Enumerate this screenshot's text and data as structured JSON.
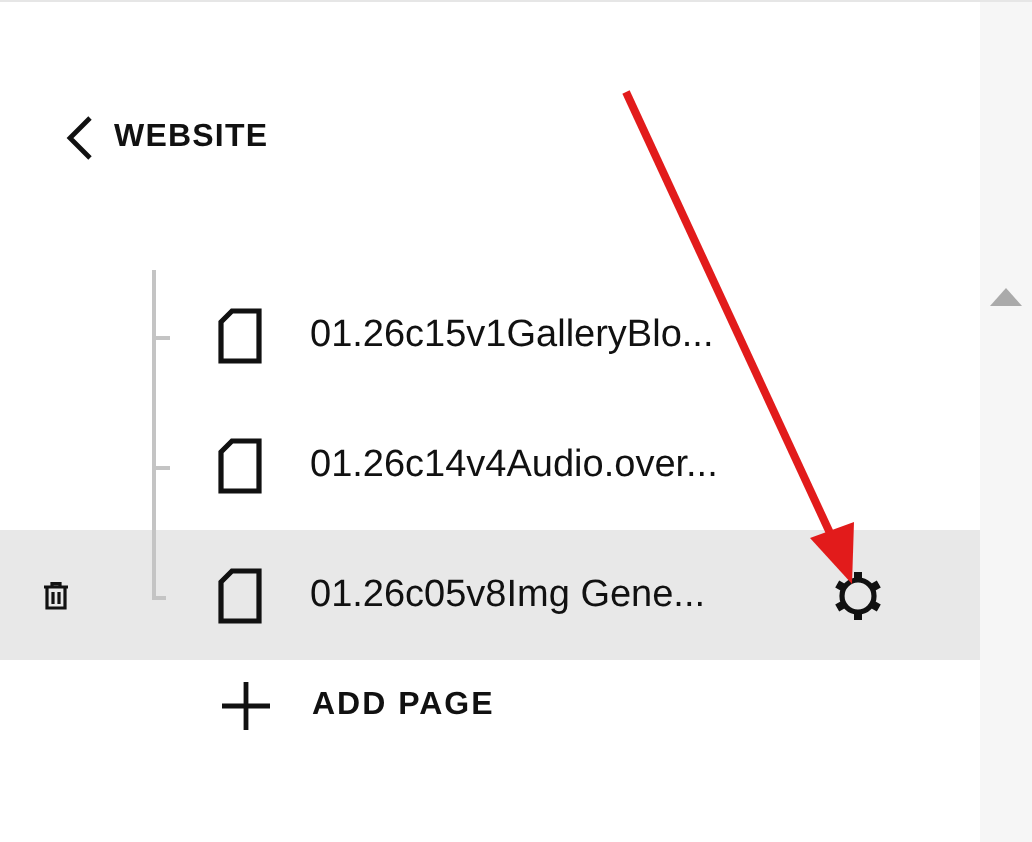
{
  "back": {
    "label": "WEBSITE"
  },
  "pages": [
    {
      "title": "01.26c15v1GalleryBlo...",
      "selected": false
    },
    {
      "title": "01.26c14v4Audio.over...",
      "selected": false
    },
    {
      "title": "01.26c05v8Img Gene...",
      "selected": true
    }
  ],
  "add_page": {
    "label": "ADD PAGE"
  }
}
